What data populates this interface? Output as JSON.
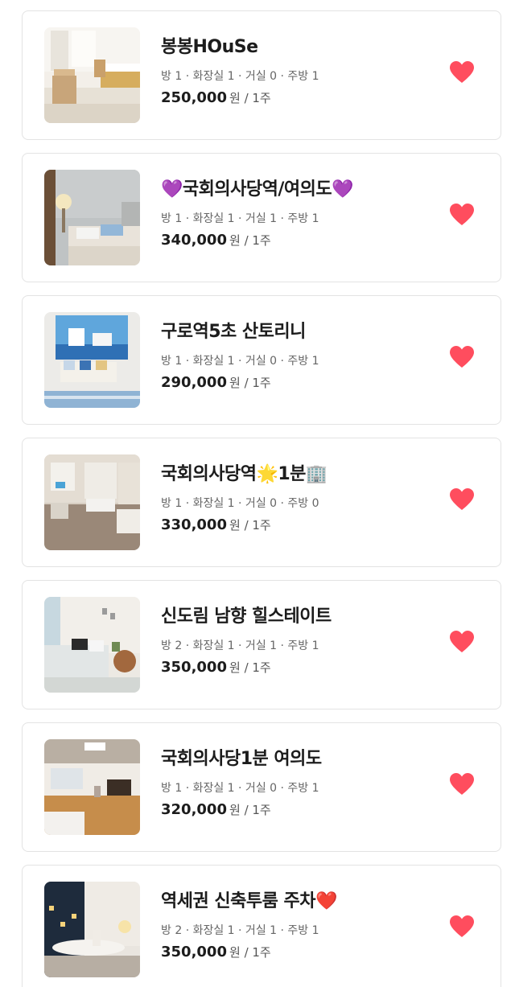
{
  "listings": [
    {
      "title": "봉봉HOuSe",
      "meta": "방 1 · 화장실 1 · 거실 0 · 주방 1",
      "price": "250,000",
      "unit": "원",
      "period": " / 1주",
      "liked": true
    },
    {
      "title": "💜국회의사당역/여의도💜",
      "meta": "방 1 · 화장실 1 · 거실 1 · 주방 1",
      "price": "340,000",
      "unit": "원",
      "period": " / 1주",
      "liked": true
    },
    {
      "title": "구로역5초 산토리니",
      "meta": "방 1 · 화장실 1 · 거실 0 · 주방 1",
      "price": "290,000",
      "unit": "원",
      "period": " / 1주",
      "liked": true
    },
    {
      "title": "국회의사당역🌟1분🏢",
      "meta": "방 1 · 화장실 1 · 거실 0 · 주방 0",
      "price": "330,000",
      "unit": "원",
      "period": " / 1주",
      "liked": true
    },
    {
      "title": "신도림 남향 힐스테이트",
      "meta": "방 2 · 화장실 1 · 거실 1 · 주방 1",
      "price": "350,000",
      "unit": "원",
      "period": " / 1주",
      "liked": true
    },
    {
      "title": "국회의사당1분 여의도",
      "meta": "방 1 · 화장실 1 · 거실 0 · 주방 1",
      "price": "320,000",
      "unit": "원",
      "period": " / 1주",
      "liked": true
    },
    {
      "title": "역세권 신축투룸 주차❤️",
      "meta": "방 2 · 화장실 1 · 거실 1 · 주방 1",
      "price": "350,000",
      "unit": "원",
      "period": " / 1주",
      "liked": true
    }
  ],
  "colors": {
    "heart": "#ff4d5e",
    "title": "#1c1c1c",
    "meta": "#666666",
    "border": "#e3e3e3"
  }
}
